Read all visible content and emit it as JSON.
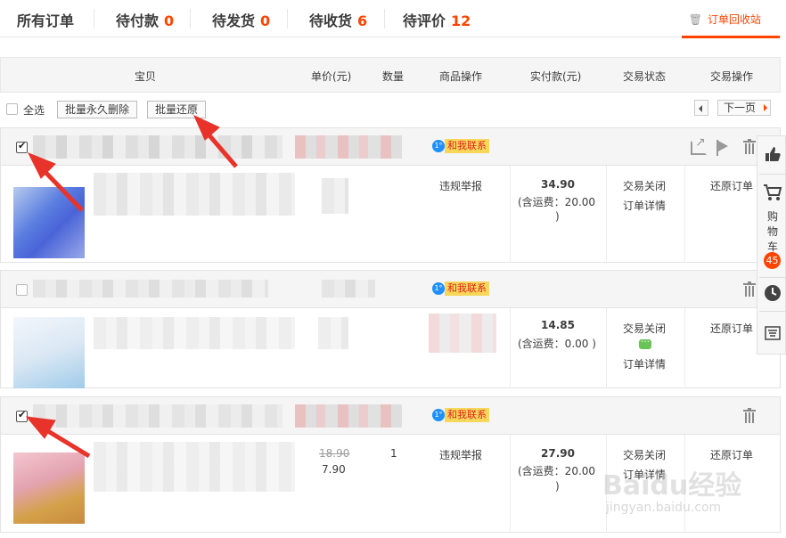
{
  "tabs": {
    "all": "所有订单",
    "pending_pay": {
      "label": "待付款",
      "count": "0"
    },
    "pending_ship": {
      "label": "待发货",
      "count": "0"
    },
    "pending_receive": {
      "label": "待收货",
      "count": "6"
    },
    "pending_review": {
      "label": "待评价",
      "count": "12"
    },
    "recycle_bin": "订单回收站"
  },
  "table_header": {
    "item": "宝贝",
    "unit_price": "单价(元)",
    "quantity": "数量",
    "item_ops": "商品操作",
    "paid": "实付款(元)",
    "status": "交易状态",
    "ops": "交易操作"
  },
  "toolbar": {
    "select_all": "全选",
    "batch_delete": "批量永久删除",
    "batch_restore": "批量还原",
    "next_page": "下一页"
  },
  "orders": [
    {
      "checked": true,
      "contact": "和我联系",
      "item_op": "违规举报",
      "original_price": "",
      "unit_price": "",
      "quantity": "",
      "paid": "34.90",
      "shipping_line1": "(含运费：20.00",
      "shipping_line2": ")",
      "status": "交易关闭",
      "detail": "订单详情",
      "action": "还原订单"
    },
    {
      "checked": false,
      "contact": "和我联系",
      "item_op": "",
      "original_price": "",
      "unit_price": "",
      "quantity": "",
      "paid": "14.85",
      "shipping_line1": "(含运费：0.00 )",
      "shipping_line2": "",
      "status": "交易关闭",
      "detail": "订单详情",
      "action": "还原订单"
    },
    {
      "checked": true,
      "contact": "和我联系",
      "item_op": "违规举报",
      "original_price": "18.90",
      "unit_price": "7.90",
      "quantity": "1",
      "paid": "27.90",
      "shipping_line1": "(含运费：20.00",
      "shipping_line2": ")",
      "status": "交易关闭",
      "detail": "订单详情",
      "action": "还原订单"
    }
  ],
  "sidebar": {
    "cart_label": "购物车",
    "cart_count": "45",
    "icons": [
      "thumbs-up-icon",
      "cart-icon",
      "clock-icon",
      "coupon-icon"
    ]
  },
  "watermark": {
    "main": "Baidu经验",
    "sub": "jingyan.baidu.com"
  },
  "colors": {
    "accent": "#ff4400",
    "contact_bg": "#f8d85a",
    "arrow": "#e8332a",
    "cart_badge": "#ff4400"
  }
}
